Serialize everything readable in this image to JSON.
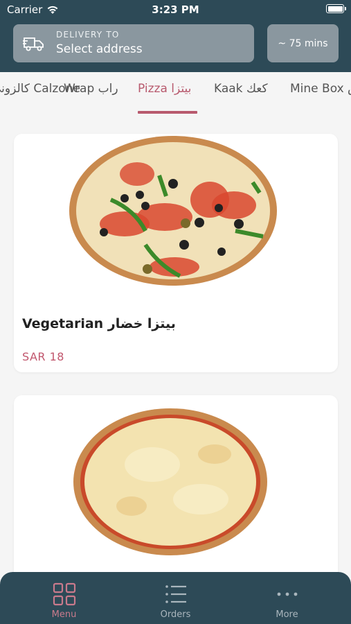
{
  "status_bar": {
    "carrier": "Carrier",
    "time": "3:23 PM"
  },
  "header": {
    "delivery_label": "DELIVERY TO",
    "address_value": "Select address",
    "eta": "~ 75 mins"
  },
  "tabs": [
    {
      "label": "كالزوني Calzone"
    },
    {
      "label": "Wrap راب"
    },
    {
      "label": "Pizza بيتزا",
      "active": true
    },
    {
      "label": "Kaak كعك"
    },
    {
      "label": "Mine Box مين بوكس"
    }
  ],
  "items": [
    {
      "title": "Vegetarian بيتزا خضار",
      "price": "SAR 18"
    },
    {
      "title": "",
      "price": ""
    }
  ],
  "bottom_nav": [
    {
      "label": "Menu",
      "icon": "grid-icon",
      "active": true
    },
    {
      "label": "Orders",
      "icon": "list-icon"
    },
    {
      "label": "More",
      "icon": "more-dots-icon"
    }
  ],
  "colors": {
    "header_bg": "#2d4a57",
    "accent": "#b85a6e",
    "price": "#c1566d",
    "background": "#f5f5f5"
  }
}
